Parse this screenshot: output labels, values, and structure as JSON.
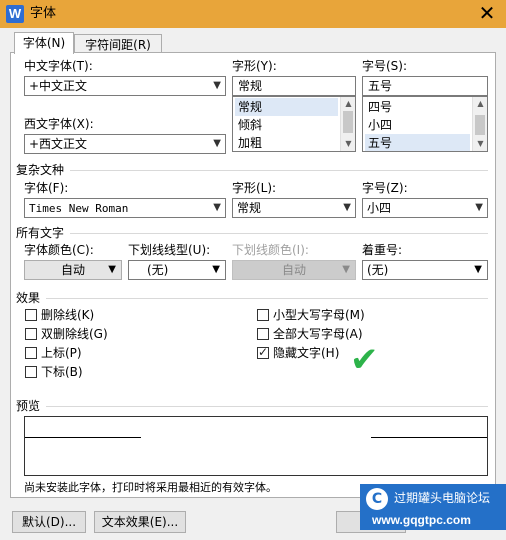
{
  "window": {
    "icon_letter": "W",
    "title": "字体",
    "close_glyph": "✕"
  },
  "tabs": [
    {
      "label": "字体(N)",
      "active": true
    },
    {
      "label": "字符间距(R)",
      "active": false
    }
  ],
  "font_section": {
    "chinese_font_label": "中文字体(T):",
    "chinese_font_value": "+中文正文",
    "western_font_label": "西文字体(X):",
    "western_font_value": "+西文正文",
    "style_label": "字形(Y):",
    "style_value": "常规",
    "style_options": [
      "常规",
      "倾斜",
      "加粗"
    ],
    "size_label": "字号(S):",
    "size_value": "五号",
    "size_options": [
      "四号",
      "小四",
      "五号"
    ]
  },
  "complex_section": {
    "title": "复杂文种",
    "font_label": "字体(F):",
    "font_value": "Times New Roman",
    "style_label": "字形(L):",
    "style_value": "常规",
    "size_label": "字号(Z):",
    "size_value": "小四"
  },
  "all_text_section": {
    "title": "所有文字",
    "font_color_label": "字体颜色(C):",
    "font_color_value": "自动",
    "underline_type_label": "下划线线型(U):",
    "underline_type_value": "(无)",
    "underline_color_label": "下划线颜色(I):",
    "underline_color_value": "自动",
    "emphasis_label": "着重号:",
    "emphasis_value": "(无)"
  },
  "effects_section": {
    "title": "效果",
    "left": [
      {
        "label": "删除线(K)",
        "checked": false
      },
      {
        "label": "双删除线(G)",
        "checked": false
      },
      {
        "label": "上标(P)",
        "checked": false
      },
      {
        "label": "下标(B)",
        "checked": false
      }
    ],
    "right": [
      {
        "label": "小型大写字母(M)",
        "checked": false
      },
      {
        "label": "全部大写字母(A)",
        "checked": false
      },
      {
        "label": "隐藏文字(H)",
        "checked": true
      }
    ],
    "annotation_mark": "✔"
  },
  "preview_section": {
    "title": "预览",
    "note": "尚未安装此字体，打印时将采用最相近的有效字体。"
  },
  "buttons": {
    "default_label": "默认(D)...",
    "text_effects_label": "文本效果(E)..."
  },
  "watermark": {
    "title": "过期罐头电脑论坛",
    "url": "www.gqgtpc.com"
  },
  "colors": {
    "title_bar": "#e8a53a",
    "watermark_bg": "#2470c8",
    "check_mark": "#2db34a"
  }
}
